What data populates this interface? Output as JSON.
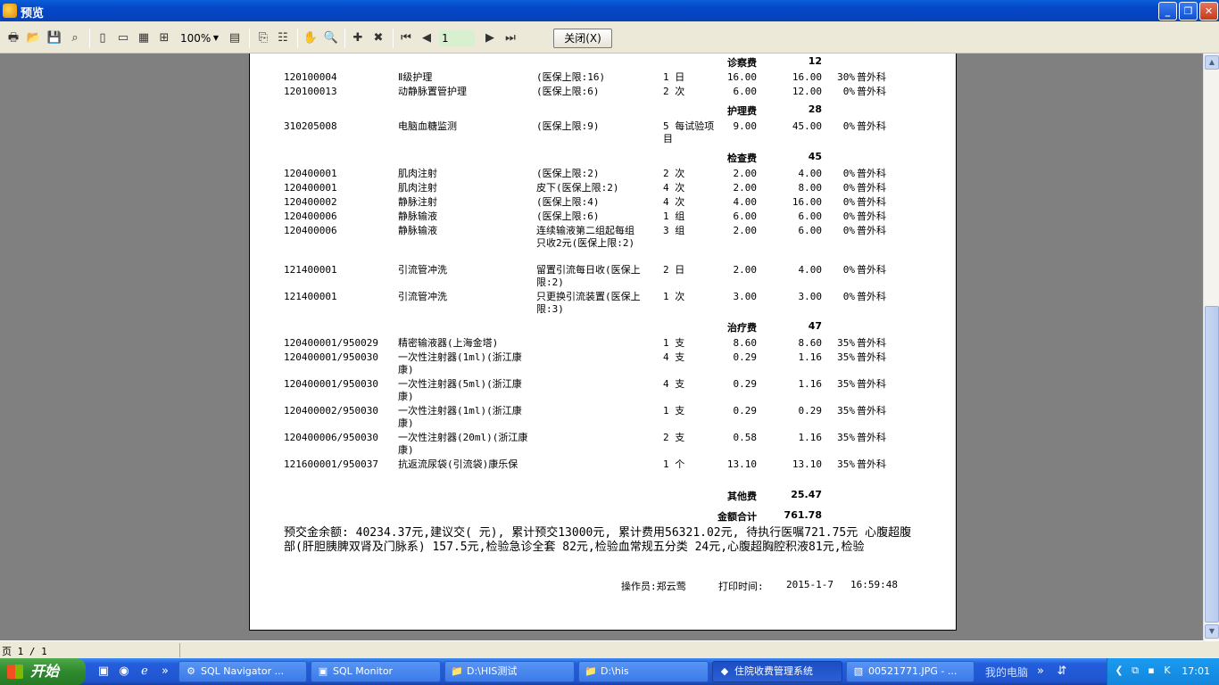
{
  "window": {
    "title": "预览"
  },
  "toolbar": {
    "zoom": "100%",
    "page_input": "1",
    "close_label": "关闭(X)"
  },
  "report": {
    "categories": [
      {
        "label": "诊察费",
        "value": "12"
      },
      {
        "label": "护理费",
        "value": "28"
      },
      {
        "label": "检查费",
        "value": "45"
      },
      {
        "label": "治疗费",
        "value": "47"
      },
      {
        "label": "其他费",
        "value": "25.47"
      },
      {
        "label": "金额合计",
        "value": "761.78"
      }
    ],
    "rows": [
      {
        "code": "120100004",
        "name": "Ⅱ级护理",
        "note": "(医保上限:16)",
        "qty": "1 日",
        "price": "16.00",
        "amount": "16.00",
        "rate": "30%",
        "dept": "普外科"
      },
      {
        "code": "120100013",
        "name": "动静脉置管护理",
        "note": "(医保上限:6)",
        "qty": "2 次",
        "price": "6.00",
        "amount": "12.00",
        "rate": "0%",
        "dept": "普外科"
      },
      {
        "code": "310205008",
        "name": "电脑血糖监测",
        "note": "(医保上限:9)",
        "qty": "5 每试验项目",
        "price": "9.00",
        "amount": "45.00",
        "rate": "0%",
        "dept": "普外科"
      },
      {
        "code": "120400001",
        "name": "肌肉注射",
        "note": "(医保上限:2)",
        "qty": "2 次",
        "price": "2.00",
        "amount": "4.00",
        "rate": "0%",
        "dept": "普外科"
      },
      {
        "code": "120400001",
        "name": "肌肉注射",
        "note": "皮下(医保上限:2)",
        "qty": "4 次",
        "price": "2.00",
        "amount": "8.00",
        "rate": "0%",
        "dept": "普外科"
      },
      {
        "code": "120400002",
        "name": "静脉注射",
        "note": "(医保上限:4)",
        "qty": "4 次",
        "price": "4.00",
        "amount": "16.00",
        "rate": "0%",
        "dept": "普外科"
      },
      {
        "code": "120400006",
        "name": "静脉输液",
        "note": "(医保上限:6)",
        "qty": "1 组",
        "price": "6.00",
        "amount": "6.00",
        "rate": "0%",
        "dept": "普外科"
      },
      {
        "code": "120400006",
        "name": "静脉输液",
        "note": "连续输液第二组起每组只收2元(医保上限:2)",
        "qty": "3 组",
        "price": "2.00",
        "amount": "6.00",
        "rate": "0%",
        "dept": "普外科"
      },
      {
        "code": "121400001",
        "name": "引流管冲洗",
        "note": "留置引流每日收(医保上限:2)",
        "qty": "2 日",
        "price": "2.00",
        "amount": "4.00",
        "rate": "0%",
        "dept": "普外科"
      },
      {
        "code": "121400001",
        "name": "引流管冲洗",
        "note": "只更换引流装置(医保上限:3)",
        "qty": "1 次",
        "price": "3.00",
        "amount": "3.00",
        "rate": "0%",
        "dept": "普外科"
      },
      {
        "code": "120400001/950029",
        "name": "精密输液器(上海金塔)",
        "note": "",
        "qty": "1 支",
        "price": "8.60",
        "amount": "8.60",
        "rate": "35%",
        "dept": "普外科"
      },
      {
        "code": "120400001/950030",
        "name": "一次性注射器(1ml)(浙江康康)",
        "note": "",
        "qty": "4 支",
        "price": "0.29",
        "amount": "1.16",
        "rate": "35%",
        "dept": "普外科"
      },
      {
        "code": "120400001/950030",
        "name": "一次性注射器(5ml)(浙江康康)",
        "note": "",
        "qty": "4 支",
        "price": "0.29",
        "amount": "1.16",
        "rate": "35%",
        "dept": "普外科"
      },
      {
        "code": "120400002/950030",
        "name": "一次性注射器(1ml)(浙江康康)",
        "note": "",
        "qty": "1 支",
        "price": "0.29",
        "amount": "0.29",
        "rate": "35%",
        "dept": "普外科"
      },
      {
        "code": "120400006/950030",
        "name": "一次性注射器(20ml)(浙江康康)",
        "note": "",
        "qty": "2 支",
        "price": "0.58",
        "amount": "1.16",
        "rate": "35%",
        "dept": "普外科"
      },
      {
        "code": "121600001/950037",
        "name": "抗返流尿袋(引流袋)康乐保",
        "note": "",
        "qty": "1 个",
        "price": "13.10",
        "amount": "13.10",
        "rate": "35%",
        "dept": "普外科"
      }
    ],
    "summary": "预交金余额: 40234.37元,建议交(     元), 累计预交13000元, 累计费用56321.02元, 待执行医嘱721.75元 心腹超腹部(肝胆胰脾双肾及门脉系) 157.5元,检验急诊全套 82元,检验血常规五分类 24元,心腹超胸腔积液81元,检验",
    "operator": "操作员:郑云莺",
    "print_time_label": "打印时间:",
    "print_date": "2015-1-7",
    "print_clock": "16:59:48"
  },
  "status": {
    "page": "页 1 / 1"
  },
  "taskbar": {
    "start": "开始",
    "tasks": [
      {
        "label": "SQL Navigator ...",
        "icon": "gear-icon"
      },
      {
        "label": "SQL Monitor",
        "icon": "monitor-icon"
      },
      {
        "label": "D:\\HIS测试",
        "icon": "folder-icon"
      },
      {
        "label": "D:\\his",
        "icon": "folder-icon"
      },
      {
        "label": "住院收费管理系统",
        "icon": "app-icon"
      },
      {
        "label": "00521771.JPG - ...",
        "icon": "image-icon"
      }
    ],
    "my_computer": "我的电脑",
    "clock": "17:01"
  }
}
